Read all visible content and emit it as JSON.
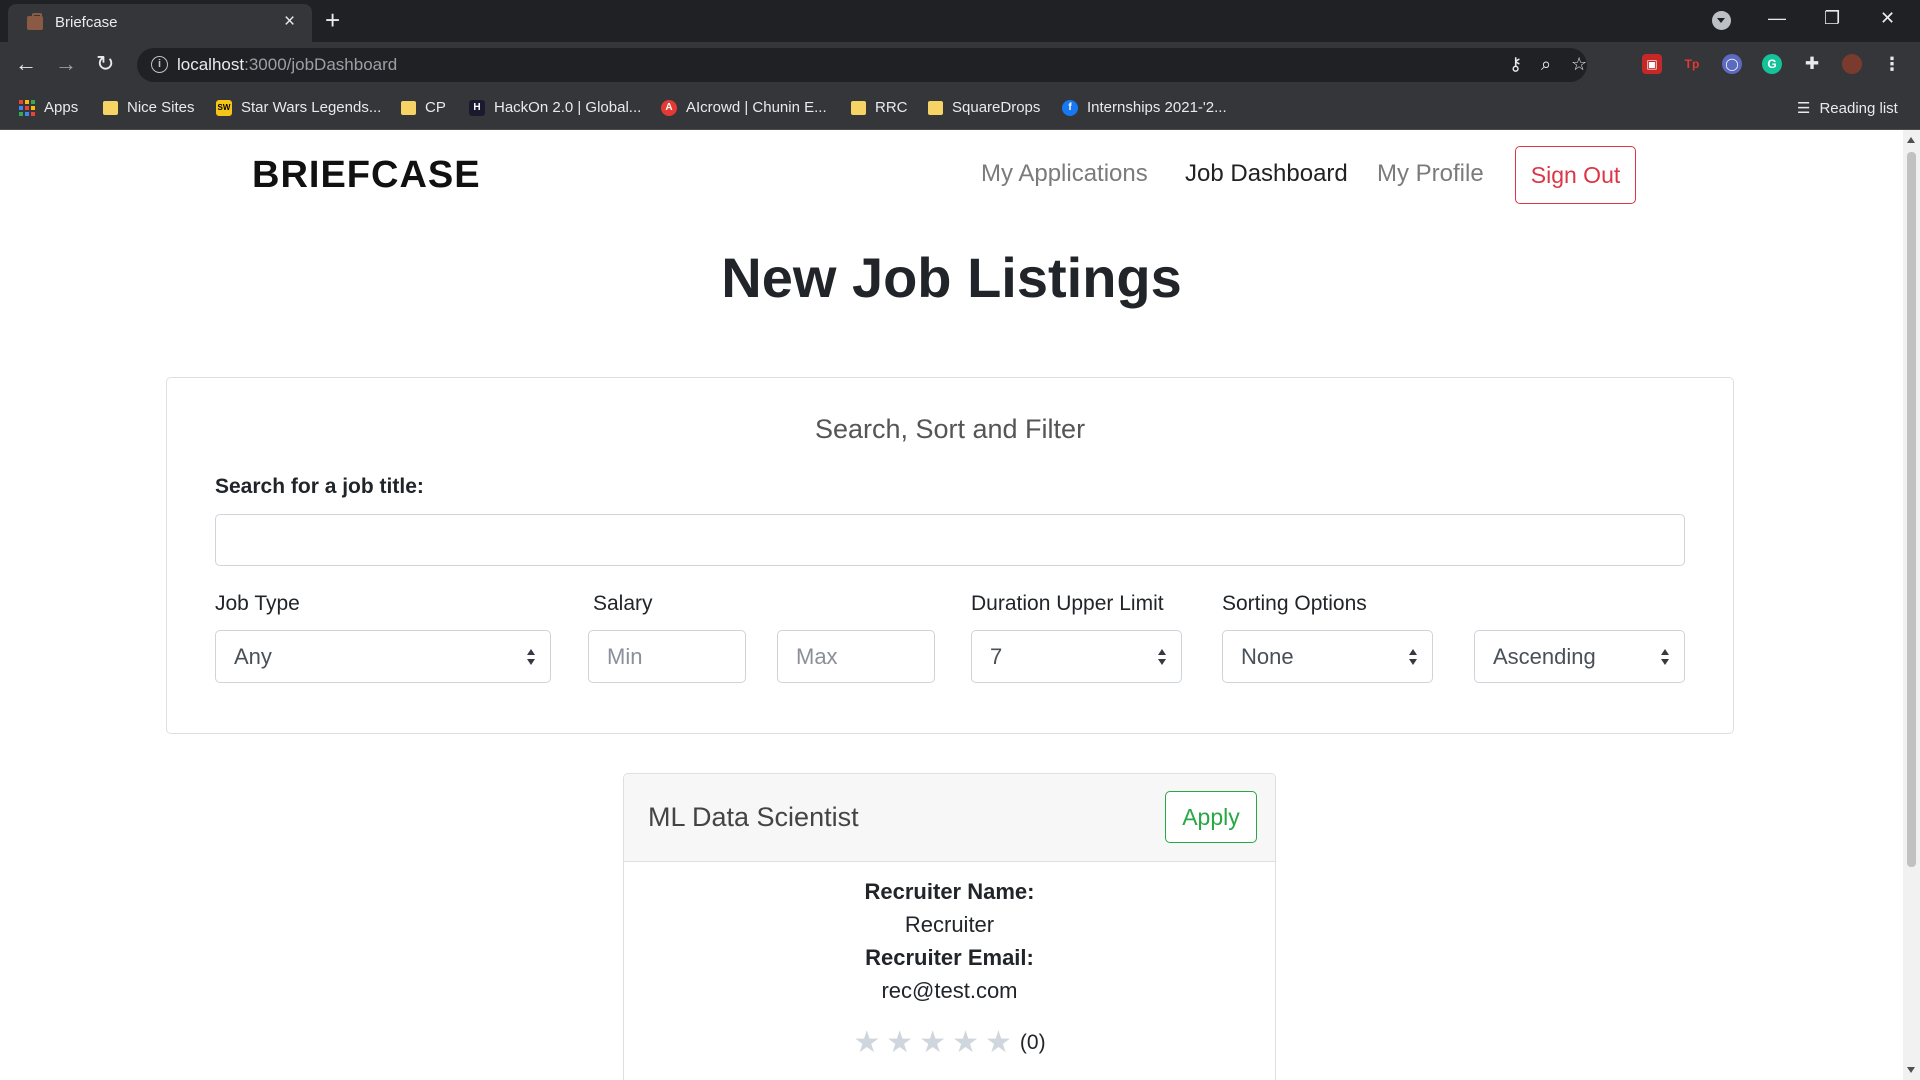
{
  "browser": {
    "tab_title": "Briefcase",
    "tab_close": "×",
    "new_tab": "+",
    "url_host": "localhost",
    "url_path": ":3000/jobDashboard",
    "window_controls": {
      "minimize": "—",
      "restore": "❐",
      "close": "✕"
    },
    "nav": {
      "back": "←",
      "forward": "→",
      "reload": "↻"
    },
    "bookmarks": [
      {
        "label": "Apps",
        "icon": "apps-grid-icon"
      },
      {
        "label": "Nice Sites",
        "icon": "folder-icon"
      },
      {
        "label": "Star Wars Legends...",
        "icon": "starwars-icon"
      },
      {
        "label": "CP",
        "icon": "folder-icon"
      },
      {
        "label": "HackOn 2.0 | Global...",
        "icon": "hackon-icon"
      },
      {
        "label": "AIcrowd | Chunin E...",
        "icon": "aicrowd-icon"
      },
      {
        "label": "RRC",
        "icon": "folder-icon"
      },
      {
        "label": "SquareDrops",
        "icon": "folder-icon"
      },
      {
        "label": "Internships 2021-'2...",
        "icon": "facebook-icon"
      }
    ],
    "reading_list": "Reading list"
  },
  "navbar": {
    "brand": "BRIEFCASE",
    "links": [
      "My Applications",
      "Job Dashboard",
      "My Profile"
    ],
    "active_link": "Job Dashboard",
    "sign_out": "Sign Out"
  },
  "page": {
    "title": "New Job Listings"
  },
  "filters": {
    "header": "Search, Sort and Filter",
    "search_label": "Search for a job title:",
    "search_value": "",
    "job_type_label": "Job Type",
    "job_type_value": "Any",
    "salary_label": "Salary",
    "salary_min_placeholder": "Min",
    "salary_max_placeholder": "Max",
    "duration_label": "Duration Upper Limit",
    "duration_value": "7",
    "sorting_label": "Sorting Options",
    "sort_by_value": "None",
    "sort_order_value": "Ascending"
  },
  "jobs": [
    {
      "title": "ML Data Scientist",
      "apply_label": "Apply",
      "recruiter_name_label": "Recruiter Name:",
      "recruiter_name": "Recruiter",
      "recruiter_email_label": "Recruiter Email:",
      "recruiter_email": "rec@test.com",
      "rating_stars": 0,
      "rating_count": "(0)"
    }
  ],
  "colors": {
    "sign_out": "#dc3545",
    "apply": "#28a745",
    "chrome_dark": "#202124",
    "chrome_toolbar": "#35363a"
  }
}
